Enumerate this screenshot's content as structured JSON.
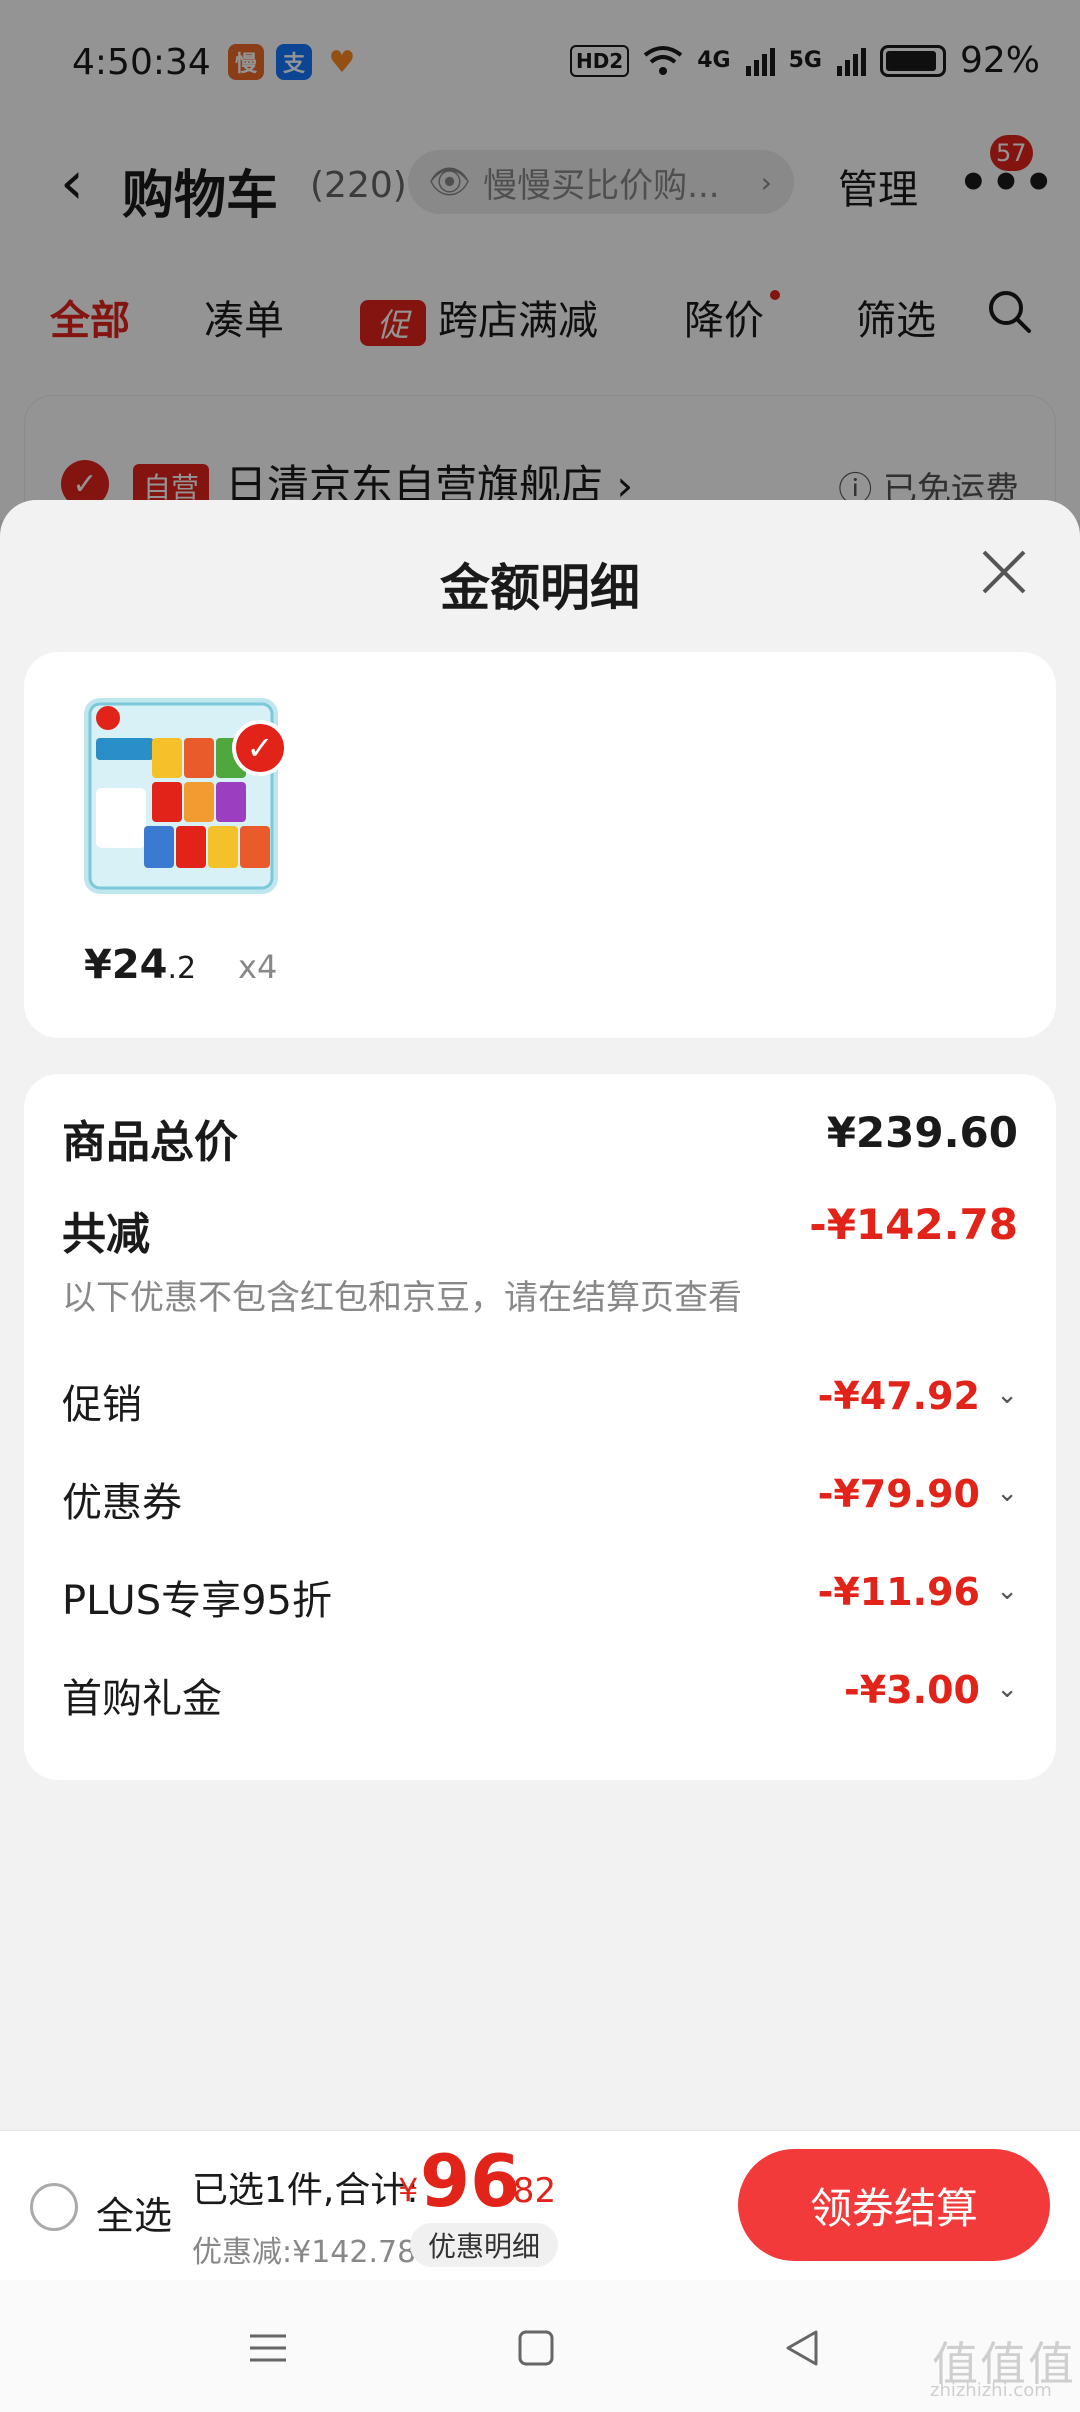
{
  "status_bar": {
    "time": "4:50:34",
    "app_icons": [
      {
        "name": "manman-app-icon",
        "glyph": "慢",
        "color": "#f06a2a"
      },
      {
        "name": "alipay-app-icon",
        "glyph": "支",
        "color": "#1677ff"
      },
      {
        "name": "heart-app-icon",
        "glyph": "♥",
        "color": "#ff8a1f"
      }
    ],
    "hd_label": "HD2",
    "net_1": "4G",
    "net_2": "5G",
    "battery": "92%",
    "battery_level": 0.92
  },
  "nav": {
    "title": "购物车",
    "count": "(220)",
    "watch_text": "慢慢买比价购...",
    "manage": "管理",
    "more_badge": "57"
  },
  "tabs": [
    "全部",
    "凑单",
    "跨店满减",
    "降价",
    "筛选"
  ],
  "promo_badge": "促",
  "store": {
    "tag": "自营",
    "name": "日清京东自营旗舰店 ›",
    "ship": "ⓘ 已免运费"
  },
  "sheet": {
    "title": "金额明细",
    "product": {
      "price_int": "¥24",
      "price_dec": ".2",
      "qty": "x4"
    },
    "summary": {
      "total_label": "商品总价",
      "total_value": "¥239.60",
      "reduce_label": "共减",
      "reduce_value": "-¥142.78",
      "reduce_note": "以下优惠不包含红包和京豆，请在结算页查看",
      "discounts": [
        {
          "label": "促销",
          "value": "-¥47.92"
        },
        {
          "label": "优惠券",
          "value": "-¥79.90"
        },
        {
          "label": "PLUS专享95折",
          "value": "-¥11.96"
        },
        {
          "label": "首购礼金",
          "value": "-¥3.00"
        }
      ]
    }
  },
  "bottom": {
    "select_all": "全选",
    "selected_text": "已选1件,合计:",
    "total_yen": "¥",
    "total_int": "96",
    "total_dec": ".82",
    "discount_text": "优惠减:¥142.78",
    "detail_label": "优惠明细",
    "checkout": "领券结算"
  },
  "watermark": {
    "main": "值值值",
    "sub": "zhizhizhi.com"
  },
  "colors": {
    "accent": "#e2231a",
    "button": "#f23a3a"
  }
}
